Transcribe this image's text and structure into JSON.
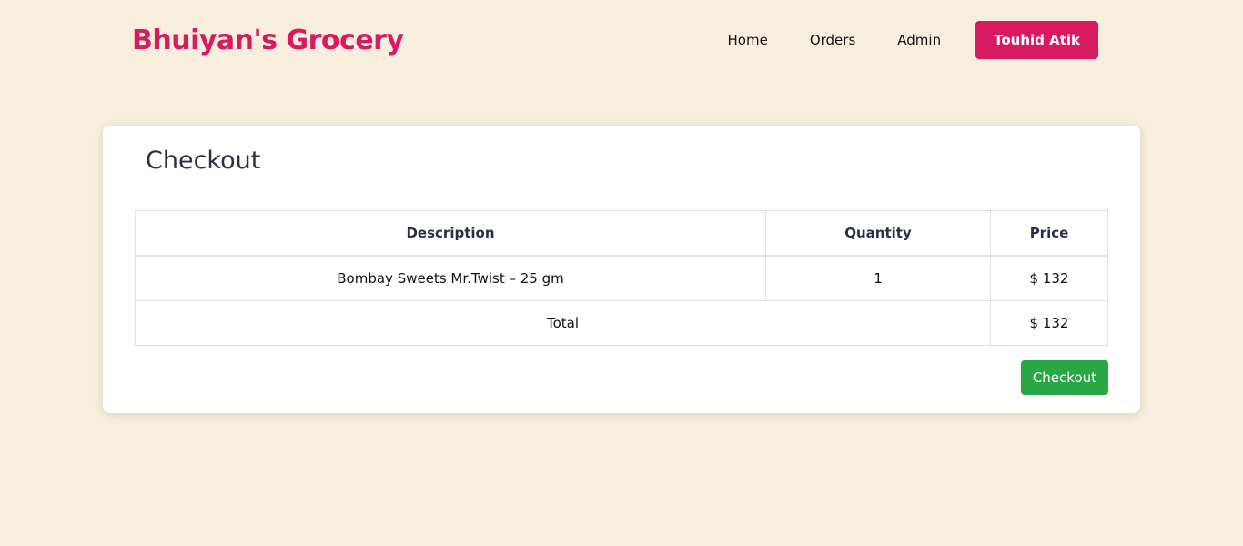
{
  "brand": {
    "name": "Bhuiyan's Grocery",
    "color": "#d81b60"
  },
  "nav": {
    "items": [
      {
        "label": "Home"
      },
      {
        "label": "Orders"
      },
      {
        "label": "Admin"
      }
    ],
    "user_button": "Touhid Atik"
  },
  "checkout": {
    "title": "Checkout",
    "columns": [
      "Description",
      "Quantity",
      "Price"
    ],
    "rows": [
      {
        "description": "Bombay Sweets Mr.Twist – 25 gm",
        "quantity": "1",
        "price": "$ 132"
      }
    ],
    "total_label": "Total",
    "total_value": "$ 132",
    "button_label": "Checkout",
    "button_color": "#28a745"
  },
  "colors": {
    "background": "#f8eedd",
    "accent": "#d81b60",
    "heading": "#2b2f48"
  }
}
